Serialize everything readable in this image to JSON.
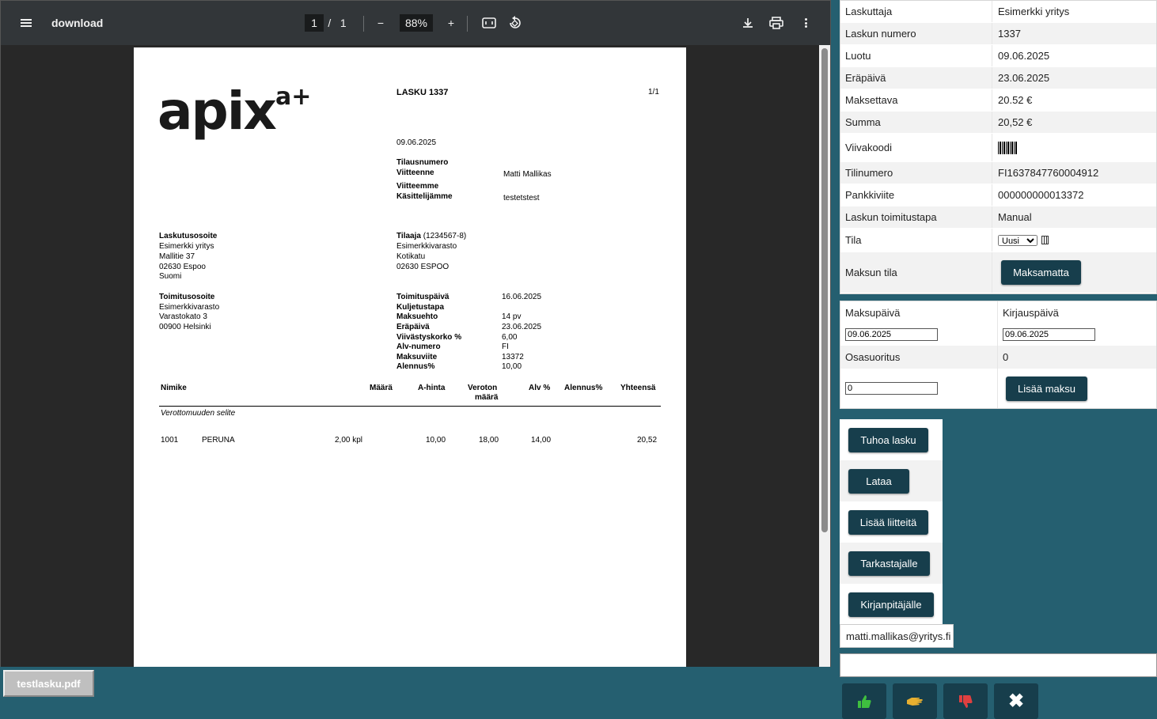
{
  "viewer": {
    "title": "download",
    "page_current": "1",
    "page_sep": "/",
    "page_total": "1",
    "zoom": "88%",
    "zoom_out": "−",
    "zoom_in": "+"
  },
  "invoice": {
    "logo": "apix",
    "logo_sup": "a+",
    "heading": "LASKU  1337",
    "page_no": "1/1",
    "date": "09.06.2025",
    "tilausnumero_label": "Tilausnumero",
    "viitteenne_label": "Viitteenne",
    "viitteenne_value": "Matti Mallikas",
    "viitteemme_label": "Viitteemme",
    "kasittelijamme_label": "Käsittelijämme",
    "kasittelijamme_value": "testetstest",
    "billing_label": "Laskutusosoite",
    "billing_lines": [
      "Esimerkki yritys",
      "Mallitie 37",
      "02630 Espoo",
      "Suomi"
    ],
    "tilaaja_label": "Tilaaja",
    "tilaaja_id": "(1234567-8)",
    "tilaaja_lines": [
      "Esimerkkivarasto",
      "Kotikatu",
      "02630 ESPOO"
    ],
    "delivery_label": "Toimitusosoite",
    "delivery_lines": [
      "Esimerkkivarasto",
      "Varastokato 3",
      "00900 Helsinki"
    ],
    "terms": [
      {
        "label": "Toimituspäivä",
        "value": "16.06.2025"
      },
      {
        "label": "Kuljetustapa",
        "value": ""
      },
      {
        "label": "Maksuehto",
        "value": "14 pv"
      },
      {
        "label": "Eräpäivä",
        "value": "23.06.2025"
      },
      {
        "label": "Viivästyskorko %",
        "value": "6,00"
      },
      {
        "label": "Alv-numero",
        "value": "FI"
      },
      {
        "label": "Maksuviite",
        "value": "13372"
      },
      {
        "label": "Alennus%",
        "value": "10,00"
      }
    ],
    "columns": {
      "nimike": "Nimike",
      "maara": "Määrä",
      "ahinta": "A-hinta",
      "veroton1": "Veroton",
      "veroton2": "määrä",
      "alv": "Alv %",
      "alennus": "Alennus%",
      "yhteensa": "Yhteensä"
    },
    "tax_note": "Verottomuuden selite",
    "row": {
      "code": "1001",
      "name": "PERUNA",
      "qty": "2,00 kpl",
      "price": "10,00",
      "net": "18,00",
      "vat": "14,00",
      "total": "20,52"
    }
  },
  "info": [
    {
      "label": "Laskuttaja",
      "value": "Esimerkki yritys"
    },
    {
      "label": "Laskun numero",
      "value": "1337"
    },
    {
      "label": "Luotu",
      "value": "09.06.2025"
    },
    {
      "label": "Eräpäivä",
      "value": "23.06.2025"
    },
    {
      "label": "Maksettava",
      "value": "20.52 €"
    },
    {
      "label": "Summa",
      "value": "20,52 €"
    },
    {
      "label": "Viivakoodi",
      "value": ""
    },
    {
      "label": "Tilinumero",
      "value": "FI1637847760004912"
    },
    {
      "label": "Pankkiviite",
      "value": "000000000013372"
    },
    {
      "label": "Laskun toimitustapa",
      "value": "Manual"
    },
    {
      "label": "Tila",
      "value": ""
    },
    {
      "label": "Maksun tila",
      "value": ""
    }
  ],
  "tila_selected": "Uusi",
  "maksun_tila_button": "Maksamatta",
  "payment": {
    "maksupaiva_label": "Maksupäivä",
    "kirjauspaiva_label": "Kirjauspäivä",
    "maksupaiva_value": "09.06.2025",
    "kirjauspaiva_value": "09.06.2025",
    "osasuoritus_label": "Osasuoritus",
    "osasuoritus_value": "0",
    "amount_value": "0",
    "add_button": "Lisää maksu"
  },
  "actions": [
    "Tuhoa lasku",
    "Lataa",
    "Lisää liitteitä",
    "Tarkastajalle",
    "Kirjanpitäjälle"
  ],
  "email": "matti.mallikas@yritys.fi",
  "file_button": "testlasku.pdf",
  "icons": {
    "approve": "thumb-up-icon",
    "delegate": "hand-icon",
    "reject": "thumb-down-icon",
    "close": "✖"
  },
  "colors": {
    "background": "#255f70",
    "button": "#173e4c",
    "approve": "#3fbf3f",
    "delegate": "#e8b030",
    "reject": "#e04040"
  }
}
